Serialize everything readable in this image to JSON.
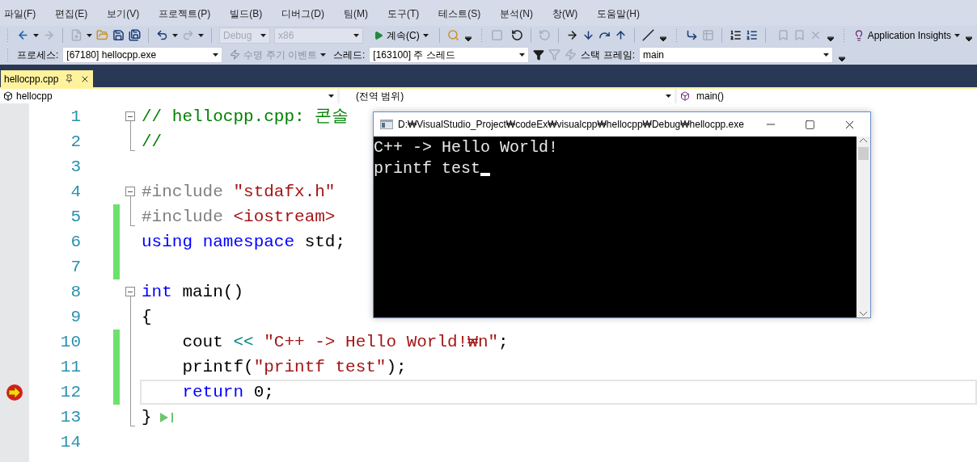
{
  "menu": [
    "파일(F)",
    "편집(E)",
    "보기(V)",
    "프로젝트(P)",
    "빌드(B)",
    "디버그(D)",
    "팀(M)",
    "도구(T)",
    "테스트(S)",
    "분석(N)",
    "창(W)",
    "도움말(H)"
  ],
  "toolbar": {
    "config_combo": {
      "value": "Debug",
      "disabled": true
    },
    "platform_combo": {
      "value": "x86",
      "disabled": true
    },
    "continue_button": "계속(C)",
    "insights_button": "Application Insights"
  },
  "debug_location": {
    "process_label": "프로세스:",
    "process": "[67180] hellocpp.exe",
    "lifecycle": {
      "label": "수명 주기 이벤트",
      "disabled": true
    },
    "thread_label": "스레드:",
    "thread": "[163100] 주 스레드",
    "stack_label": "스택 프레임:",
    "stack_frame": "main"
  },
  "tabs": [
    {
      "label": "hellocpp.cpp",
      "selected": true
    }
  ],
  "nav_bar": {
    "project": "hellocpp",
    "scope": "(전역 범위)",
    "member": "main()"
  },
  "lines": [
    {
      "number": "1",
      "changed": false,
      "fold_start": true,
      "in_fold": false,
      "fold_end": false,
      "current": false,
      "tokens": [
        {
          "kind": "comment",
          "text": "// hellocpp.cpp: 콘솔"
        }
      ]
    },
    {
      "number": "2",
      "changed": false,
      "fold_start": false,
      "in_fold": false,
      "fold_end": true,
      "current": false,
      "tokens": [
        {
          "kind": "comment",
          "text": "//"
        }
      ]
    },
    {
      "number": "3",
      "changed": false,
      "fold_start": false,
      "in_fold": false,
      "fold_end": false,
      "current": false
    },
    {
      "number": "4",
      "changed": false,
      "fold_start": true,
      "in_fold": false,
      "fold_end": false,
      "current": false,
      "tokens": [
        {
          "kind": "preproc",
          "text": "#include "
        },
        {
          "kind": "string",
          "text": "\"stdafx.h\""
        }
      ]
    },
    {
      "number": "5",
      "changed": true,
      "fold_start": false,
      "in_fold": false,
      "fold_end": true,
      "current": false,
      "tokens": [
        {
          "kind": "preproc",
          "text": "#include "
        },
        {
          "kind": "string",
          "text": "<iostream>"
        }
      ]
    },
    {
      "number": "6",
      "changed": true,
      "fold_start": false,
      "in_fold": false,
      "fold_end": false,
      "current": false,
      "tokens": [
        {
          "kind": "keyword",
          "text": "using "
        },
        {
          "kind": "keyword",
          "text": "namespace"
        },
        {
          "kind": "plain",
          "text": " std;"
        }
      ]
    },
    {
      "number": "7",
      "changed": true,
      "fold_start": false,
      "in_fold": false,
      "fold_end": false,
      "current": false
    },
    {
      "number": "8",
      "changed": false,
      "fold_start": true,
      "in_fold": false,
      "fold_end": false,
      "current": false,
      "tokens": [
        {
          "kind": "keyword",
          "text": "int"
        },
        {
          "kind": "plain",
          "text": " main()"
        }
      ]
    },
    {
      "number": "9",
      "changed": false,
      "fold_start": false,
      "in_fold": true,
      "fold_end": false,
      "current": false,
      "tokens": [
        {
          "kind": "plain",
          "text": "{"
        }
      ]
    },
    {
      "number": "10",
      "changed": true,
      "fold_start": false,
      "in_fold": true,
      "fold_end": false,
      "current": false,
      "tokens": [
        {
          "kind": "plain",
          "text": "    cout "
        },
        {
          "kind": "operator",
          "text": "<< "
        },
        {
          "kind": "string",
          "text": "\"C++ -> Hello World!₩n\""
        },
        {
          "kind": "plain",
          "text": ";"
        }
      ]
    },
    {
      "number": "11",
      "changed": true,
      "fold_start": false,
      "in_fold": true,
      "fold_end": false,
      "current": false,
      "tokens": [
        {
          "kind": "plain",
          "text": "    printf("
        },
        {
          "kind": "string",
          "text": "\"printf test\""
        },
        {
          "kind": "plain",
          "text": ");"
        }
      ]
    },
    {
      "number": "12",
      "changed": true,
      "fold_start": false,
      "in_fold": true,
      "fold_end": false,
      "current": true,
      "tokens": [
        {
          "kind": "keyword",
          "text": "    return"
        },
        {
          "kind": "plain",
          "text": " 0;"
        }
      ]
    },
    {
      "number": "13",
      "changed": false,
      "fold_start": false,
      "in_fold": false,
      "fold_end": true,
      "current": false,
      "run_to_here": true,
      "tokens": [
        {
          "kind": "plain",
          "text": "}"
        }
      ]
    },
    {
      "number": "14",
      "changed": false,
      "fold_start": false,
      "in_fold": false,
      "fold_end": false,
      "current": false
    }
  ],
  "console": {
    "title": "D:₩VisualStudio_Project₩codeEx₩visualcpp₩hellocpp₩Debug₩hellocpp.exe",
    "output": [
      "C++ -> Hello World!",
      "printf test"
    ]
  }
}
